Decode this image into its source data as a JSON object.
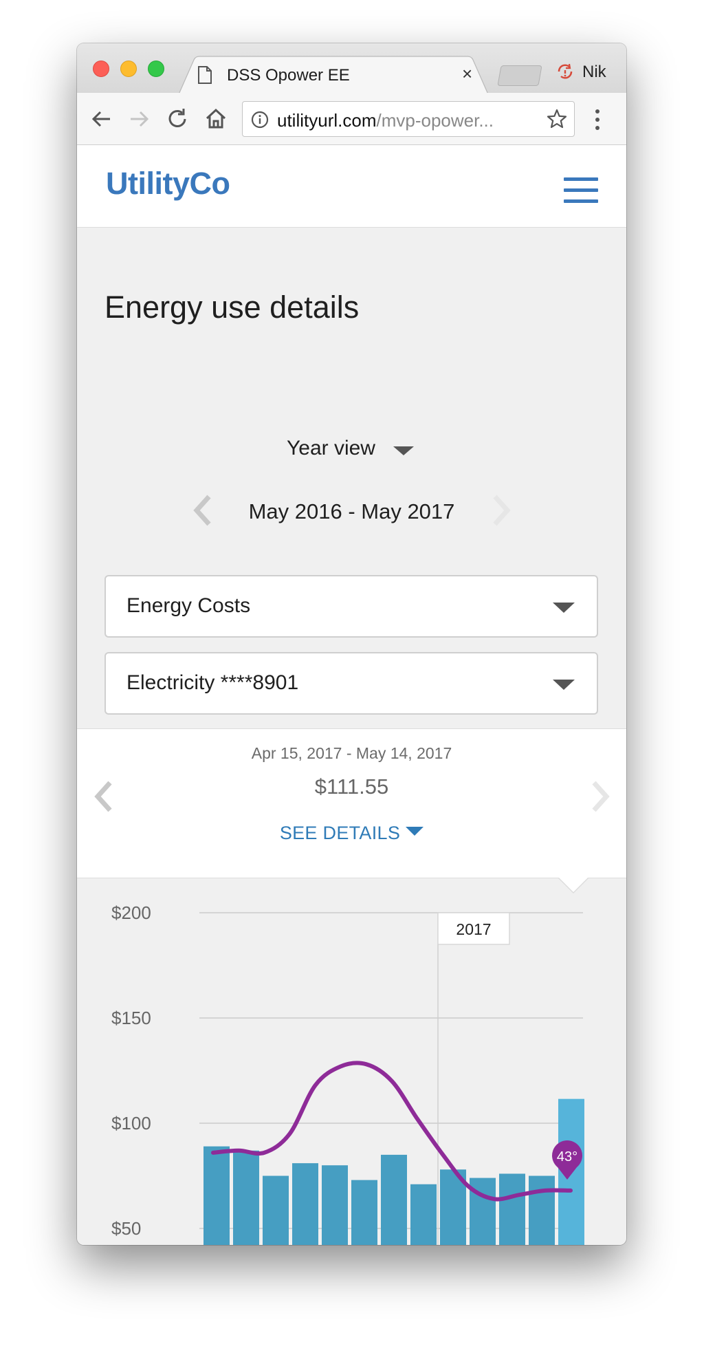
{
  "browser": {
    "tab_title": "DSS Opower EE",
    "tab_close": "×",
    "profile_name": "Nik",
    "url_host": "utilityurl.com",
    "url_path": "/mvp-opower...",
    "icons": [
      "back-arrow-icon",
      "forward-arrow-icon",
      "reload-icon",
      "home-icon",
      "info-icon",
      "star-icon",
      "menu-dots-icon",
      "document-icon",
      "profile-sync-icon"
    ]
  },
  "site": {
    "logo": "UtilityCo",
    "brand_color": "#3a78bc"
  },
  "main": {
    "title": "Energy use details",
    "view_select": "Year view",
    "date_range": "May 2016 - May 2017",
    "dropdowns": [
      {
        "label": "Energy Costs"
      },
      {
        "label": "Electricity ****8901"
      }
    ]
  },
  "summary": {
    "period": "Apr 15, 2017 - May 14, 2017",
    "amount": "$111.55",
    "see_details": "SEE DETAILS"
  },
  "chart_data": {
    "type": "bar",
    "title": "",
    "xlabel": "",
    "ylabel": "",
    "ylim": [
      0,
      200
    ],
    "yticks": [
      "$200",
      "$150",
      "$100",
      "$50"
    ],
    "ytick_values": [
      200,
      150,
      100,
      50
    ],
    "year_marker": "2017",
    "year_marker_index": 8,
    "bar_color": "#469ec2",
    "highlight_color": "#56b4da",
    "line_color": "#8e2b98",
    "series": [
      {
        "values": [
          89,
          87,
          75,
          81,
          80,
          73,
          85,
          71,
          78,
          74,
          76,
          75,
          111.55
        ],
        "highlight_index": 12
      }
    ],
    "temperature_line": [
      86,
      87,
      86,
      95,
      118,
      127,
      128,
      120,
      102,
      85,
      70,
      64,
      66,
      68,
      68
    ],
    "temperature_marker": "43°"
  }
}
